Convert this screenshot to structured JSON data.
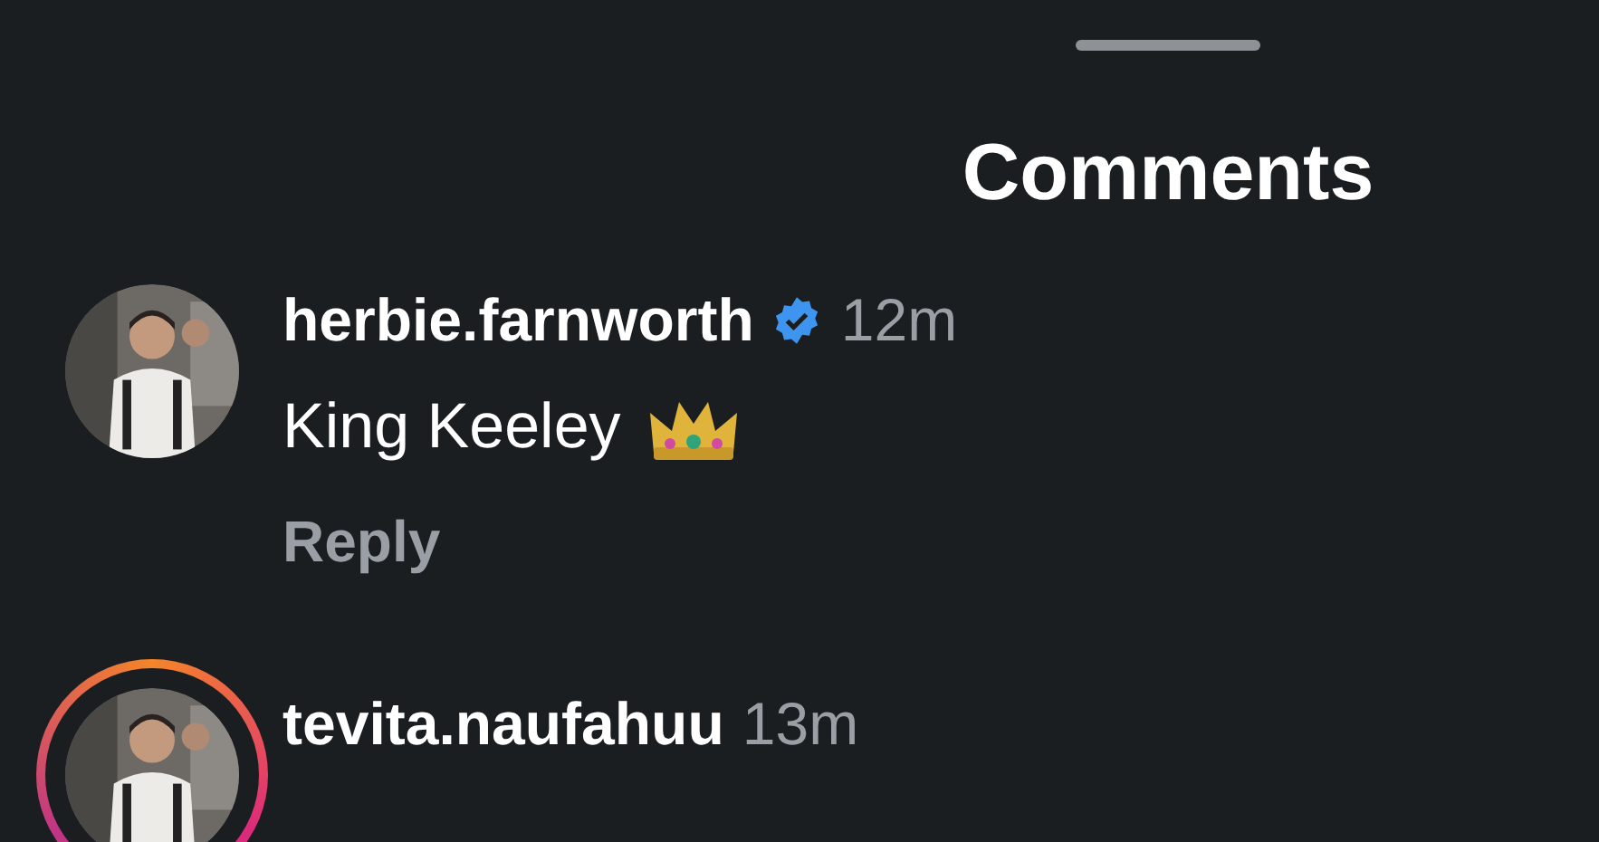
{
  "title": "Comments",
  "comments": [
    {
      "username": "herbie.farnworth",
      "verified": true,
      "time": "12m",
      "text": "King Keeley",
      "emoji": {
        "kind": "crown"
      },
      "reply": "Reply",
      "story_ring": false
    },
    {
      "username": "tevita.naufahuu",
      "verified": false,
      "time": "13m",
      "story_ring": true
    }
  ]
}
